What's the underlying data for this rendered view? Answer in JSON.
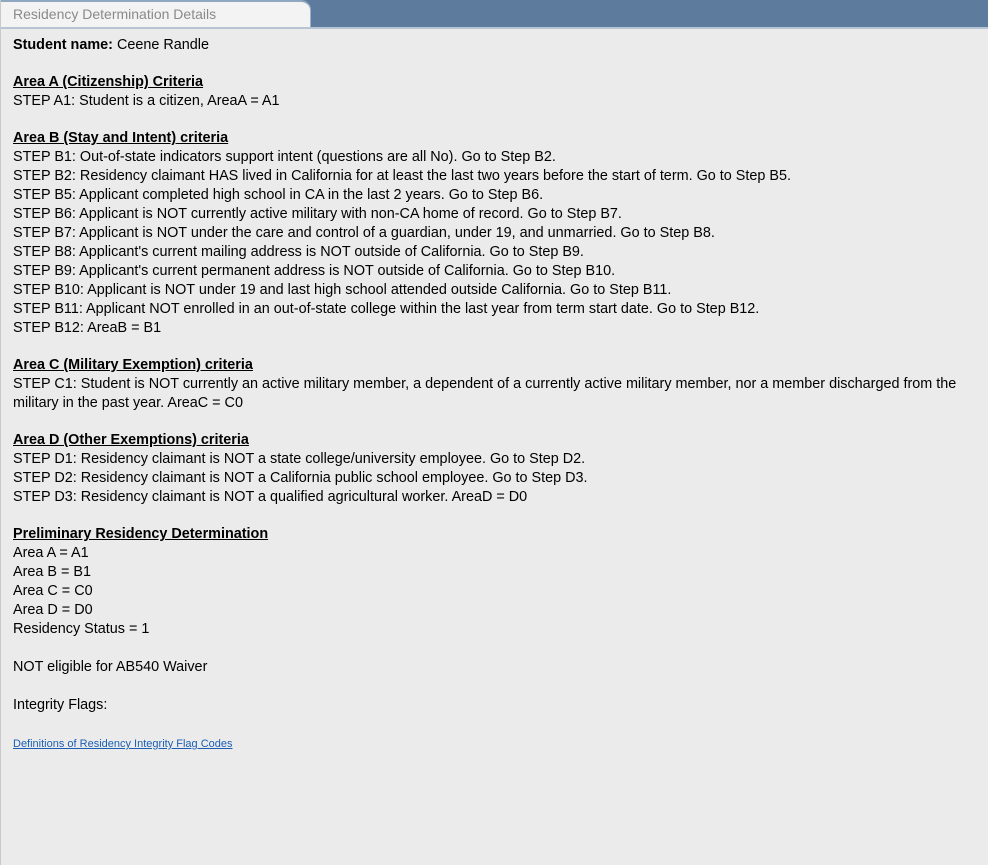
{
  "tab": {
    "label": "Residency Determination Details"
  },
  "student": {
    "label": "Student name:",
    "value": "Ceene Randle"
  },
  "area_a": {
    "title": "Area A (Citizenship) Criteria",
    "steps": [
      "STEP A1: Student is a citizen, AreaA = A1"
    ]
  },
  "area_b": {
    "title": "Area B (Stay and Intent) criteria",
    "steps": [
      "STEP B1: Out-of-state indicators support intent (questions are all No). Go to Step B2.",
      "STEP B2: Residency claimant HAS lived in California for at least the last two years before the start of term. Go to Step B5.",
      "STEP B5: Applicant completed high school in CA in the last 2 years. Go to Step B6.",
      "STEP B6: Applicant is NOT currently active military with non-CA home of record. Go to Step B7.",
      "STEP B7: Applicant is NOT under the care and control of a guardian, under 19, and unmarried. Go to Step B8.",
      "STEP B8: Applicant's current mailing address is NOT outside of California. Go to Step B9.",
      "STEP B9: Applicant's current permanent address is NOT outside of California. Go to Step B10.",
      "STEP B10: Applicant is NOT under 19 and last high school attended outside California. Go to Step B11.",
      "STEP B11: Applicant NOT enrolled in an out-of-state college within the last year from term start date. Go to Step B12.",
      "STEP B12: AreaB = B1"
    ]
  },
  "area_c": {
    "title": "Area C (Military Exemption) criteria",
    "steps": [
      "STEP C1: Student is NOT currently an active military member, a dependent of a currently active military member, nor a member discharged from the military in the past year. AreaC = C0"
    ]
  },
  "area_d": {
    "title": "Area D (Other Exemptions) criteria",
    "steps": [
      "STEP D1: Residency claimant is NOT a state college/university employee. Go to Step D2.",
      "STEP D2: Residency claimant is NOT a California public school employee. Go to Step D3.",
      "STEP D3: Residency claimant is NOT a qualified agricultural worker. AreaD = D0"
    ]
  },
  "preliminary": {
    "title": "Preliminary Residency Determination",
    "lines": [
      "Area A = A1",
      "Area B = B1",
      "Area C = C0",
      "Area D = D0",
      "Residency Status = 1"
    ]
  },
  "waiver_text": "NOT eligible for AB540 Waiver",
  "integrity_flags_label": "Integrity Flags:",
  "definitions_link": "Definitions of Residency Integrity Flag Codes"
}
